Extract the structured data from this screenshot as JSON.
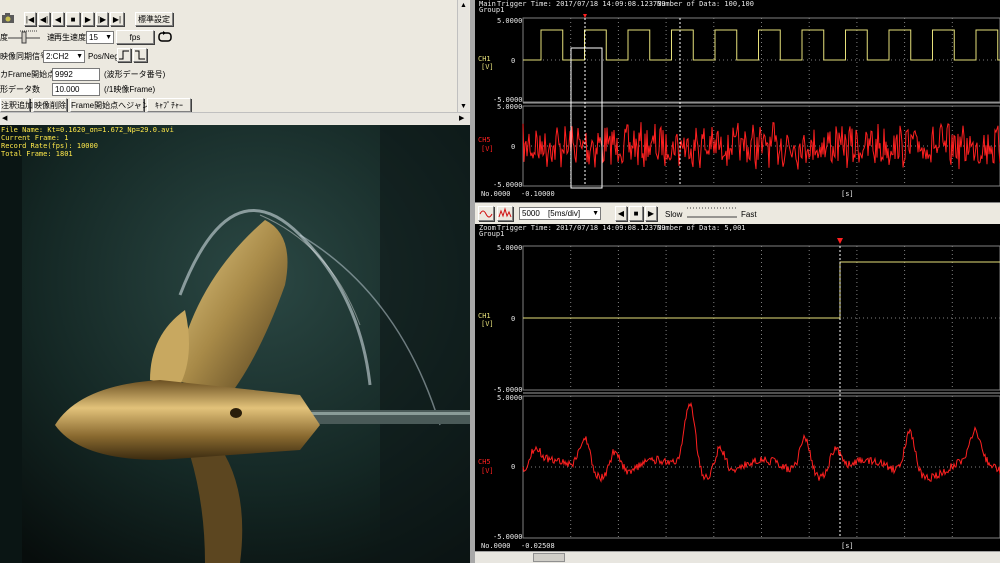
{
  "toolbar": {
    "play_controls": [
      "|◀",
      "◀|",
      "◀",
      "■",
      "▶",
      "|▶",
      "▶|"
    ],
    "standard_settings": "標準設定",
    "slider_left_label": "度",
    "slider_right_label": "速",
    "playback_speed_label": "再生速度",
    "playback_speed_value": "15",
    "fps_label": "fps",
    "sync_signal_label": "映像同期信号",
    "sync_signal_value": "2:CH2",
    "pos_neg_label": "Pos/Neg",
    "frame_start_label": "カFrame開始点",
    "frame_start_value": "9992",
    "frame_start_unit": "(波形データ番号)",
    "waveform_count_label": "形データ数",
    "waveform_count_value": "10.000",
    "waveform_count_unit": "(/1映像Frame)",
    "add_annotation": "注釈追加",
    "delete_video": "映像削除",
    "jump_frame_start": "Frame開始点へジャンプ",
    "capture": "ｷｬﾌﾟﾁｬｰ"
  },
  "video_info": {
    "file_name": "File Name: Kt=0.1620_σn=1.672_Np=29.0.avi",
    "current_frame": "Current Frame: 1",
    "record_rate": "Record Rate(fps): 10000",
    "total_frame": "Total Frame: 1801"
  },
  "main_scope": {
    "header_label": "Main",
    "group": "Group1",
    "trigger_time": "Trigger Time: 2017/07/18 14:09:08.123739",
    "num_data": "Number of Data: 100,100",
    "ch1_label": "CH1",
    "ch1_unit": "[V]",
    "ch1_top": "5.0000",
    "ch1_zero": "0",
    "ch1_bottom": "-5.0000",
    "ch5_label": "CH5",
    "ch5_unit": "[V]",
    "ch5_top": "5.0000",
    "ch5_zero": "0",
    "ch5_bottom": "-5.0000",
    "x_start": "No.0000",
    "x_start_value": "-0.10000",
    "x_unit": "[s]"
  },
  "zoom_controls": {
    "time_div_value": "5000",
    "time_div_unit": "[5ms/div]",
    "slow_label": "Slow",
    "fast_label": "Fast"
  },
  "zoom_scope": {
    "header_label": "Zoom",
    "group": "Group1",
    "trigger_time": "Trigger Time: 2017/07/18 14:09:08.123739",
    "num_data": "Number of Data: 5,001",
    "ch1_label": "CH1",
    "ch1_unit": "[V]",
    "ch1_top": "5.0000",
    "ch1_zero": "0",
    "ch1_bottom": "-5.0000",
    "ch5_label": "CH5",
    "ch5_unit": "[V]",
    "ch5_top": "5.0000",
    "ch5_zero": "0",
    "ch5_bottom": "-5.0000",
    "x_start": "No.0000",
    "x_start_value": "-0.02508",
    "x_unit": "[s]"
  },
  "colors": {
    "ch1": "#e6e07a",
    "ch5": "#ff2020",
    "grid": "#808080",
    "scope_bg": "#000000"
  }
}
